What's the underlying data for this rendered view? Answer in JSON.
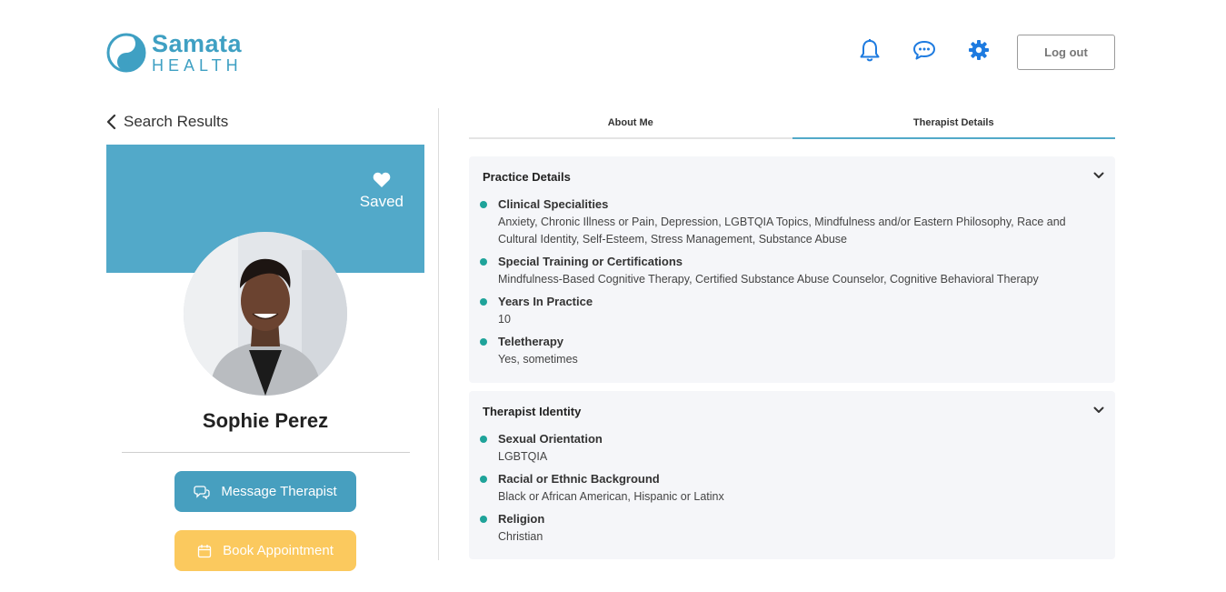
{
  "header": {
    "brand_name": "Samata",
    "brand_sub": "HEALTH",
    "icons": [
      "bell-icon",
      "chat-icon",
      "gear-icon"
    ],
    "logout_label": "Log out",
    "accent_color": "#1e7be0"
  },
  "left": {
    "back_label": "Search Results",
    "saved_label": "Saved",
    "therapist_name": "Sophie Perez",
    "message_button": "Message Therapist",
    "book_button": "Book Appointment",
    "banner_color": "#52a9c9"
  },
  "tabs": [
    {
      "label": "About Me",
      "active": false
    },
    {
      "label": "Therapist Details",
      "active": true
    }
  ],
  "sections": {
    "practice": {
      "title": "Practice Details",
      "items": [
        {
          "label": "Clinical Specialities",
          "value": "Anxiety, Chronic Illness or Pain, Depression, LGBTQIA Topics, Mindfulness and/or Eastern Philosophy, Race and Cultural Identity, Self-Esteem, Stress Management, Substance Abuse"
        },
        {
          "label": "Special Training or Certifications",
          "value": "Mindfulness-Based Cognitive Therapy, Certified Substance Abuse Counselor, Cognitive Behavioral Therapy"
        },
        {
          "label": "Years In Practice",
          "value": "10"
        },
        {
          "label": "Teletherapy",
          "value": "Yes, sometimes"
        }
      ]
    },
    "identity": {
      "title": "Therapist Identity",
      "items": [
        {
          "label": "Sexual Orientation",
          "value": "LGBTQIA"
        },
        {
          "label": "Racial or Ethnic Background",
          "value": "Black or African American, Hispanic or Latinx"
        },
        {
          "label": "Religion",
          "value": "Christian"
        }
      ]
    }
  }
}
